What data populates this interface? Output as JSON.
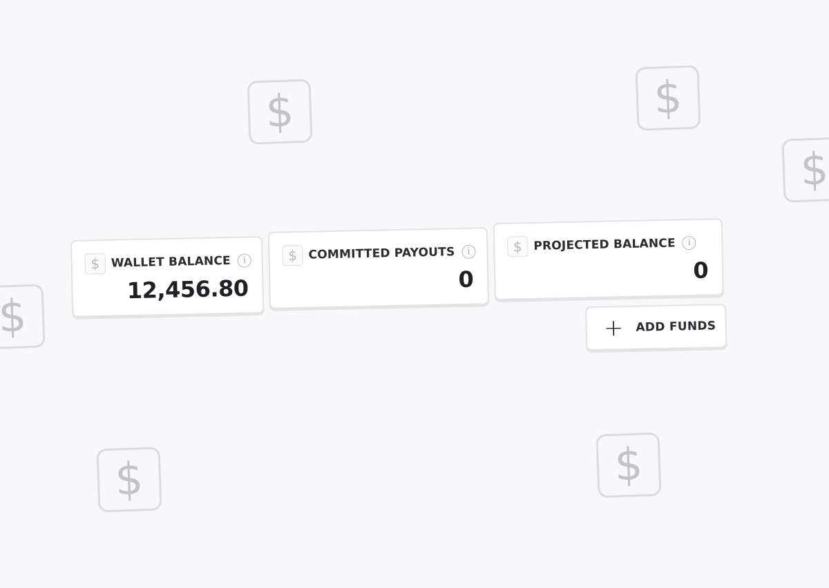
{
  "background_icons": {
    "symbol": "$",
    "icon": "dollar-sign-icon"
  },
  "cards": [
    {
      "title": "WALLET BALANCE",
      "value": "12,456.80",
      "icon": "$"
    },
    {
      "title": "COMMITTED PAYOUTS",
      "value": "0",
      "icon": "$"
    },
    {
      "title": "PROJECTED BALANCE",
      "value": "0",
      "icon": "$"
    }
  ],
  "info_glyph": "i",
  "add_funds": {
    "icon": "+",
    "label": "ADD FUNDS"
  },
  "colors": {
    "background": "#f8f7f9",
    "card_border": "#e3e3e6",
    "text": "#1f1f24",
    "muted_icon": "#c4c4c7"
  }
}
